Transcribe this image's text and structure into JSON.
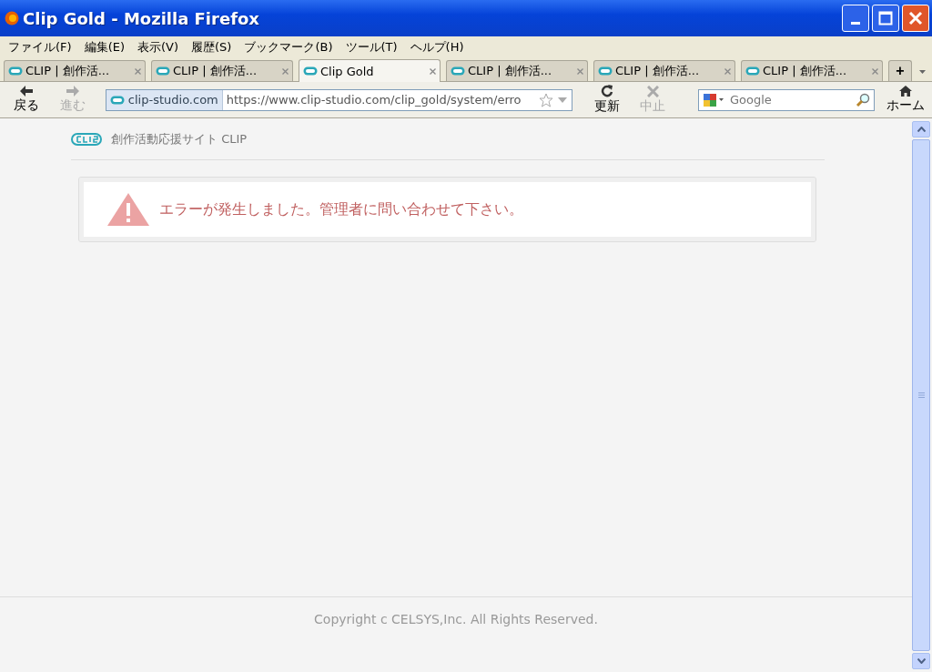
{
  "window": {
    "title": "Clip Gold - Mozilla Firefox"
  },
  "menu": [
    "ファイル(F)",
    "編集(E)",
    "表示(V)",
    "履歴(S)",
    "ブックマーク(B)",
    "ツール(T)",
    "ヘルプ(H)"
  ],
  "tabs": [
    {
      "label": "CLIP | 創作活...",
      "selected": false
    },
    {
      "label": "CLIP | 創作活...",
      "selected": false
    },
    {
      "label": "Clip Gold",
      "selected": true
    },
    {
      "label": "CLIP | 創作活...",
      "selected": false
    },
    {
      "label": "CLIP | 創作活...",
      "selected": false
    },
    {
      "label": "CLIP | 創作活...",
      "selected": false
    }
  ],
  "new_tab": "+",
  "nav_left": [
    {
      "kind": "back",
      "label": "戻る",
      "disabled": false
    },
    {
      "kind": "forward",
      "label": "進む",
      "disabled": true
    }
  ],
  "address": {
    "site": "clip-studio.com",
    "url": "https://www.clip-studio.com/clip_gold/system/erro"
  },
  "nav_mid": [
    {
      "kind": "reload",
      "label": "更新",
      "disabled": false
    },
    {
      "kind": "stop",
      "label": "中止",
      "disabled": true
    }
  ],
  "search": {
    "placeholder": "Google"
  },
  "home": {
    "label": "ホーム"
  },
  "page": {
    "site_title": "創作活動応援サイト CLIP",
    "error": "エラーが発生しました。管理者に問い合わせて下さい。",
    "footer": "Copyright c CELSYS,Inc. All Rights Reserved."
  }
}
